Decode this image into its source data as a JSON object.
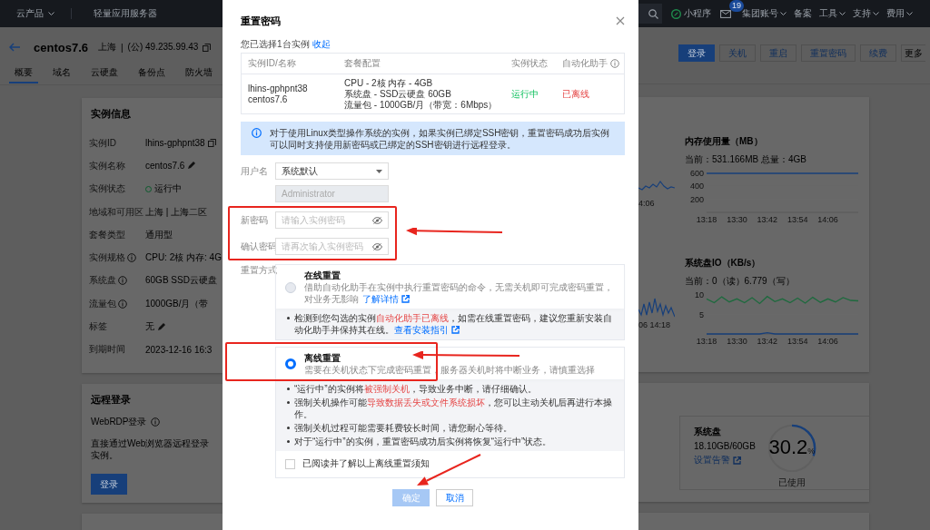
{
  "top_nav": {
    "products": "云产品",
    "service": "轻量应用服务器",
    "mini_program": "小程序",
    "mail_count": "19",
    "menus": [
      {
        "label": "集团账号",
        "dropdown": true
      },
      {
        "label": "备案",
        "dropdown": false
      },
      {
        "label": "工具",
        "dropdown": true
      },
      {
        "label": "支持",
        "dropdown": true
      },
      {
        "label": "费用",
        "dropdown": true
      }
    ]
  },
  "header": {
    "name": "centos7.6",
    "region": "上海",
    "separator": "|",
    "ip": "(公) 49.235.99.43",
    "buttons": [
      {
        "label": "登录",
        "primary": true
      },
      {
        "label": "关机",
        "primary": false
      },
      {
        "label": "重启",
        "primary": false
      },
      {
        "label": "重置密码",
        "primary": false
      },
      {
        "label": "续费",
        "primary": false
      },
      {
        "label": "更多",
        "primary": false
      }
    ]
  },
  "tabs": [
    {
      "label": "概要",
      "selected": true
    },
    {
      "label": "域名",
      "selected": false
    },
    {
      "label": "云硬盘",
      "selected": false
    },
    {
      "label": "备份点",
      "selected": false
    },
    {
      "label": "防火墙",
      "selected": false
    }
  ],
  "instance_info": {
    "title": "实例信息",
    "rows": [
      {
        "label": "实例ID",
        "label_info": false,
        "value": "lhins-gphpnt38",
        "kind": "copy"
      },
      {
        "label": "实例名称",
        "label_info": false,
        "value": "centos7.6",
        "kind": "edit"
      },
      {
        "label": "实例状态",
        "label_info": false,
        "value": "运行中",
        "kind": "status"
      },
      {
        "label": "地域和可用区",
        "label_info": false,
        "value": "上海 | 上海二区",
        "kind": "plain"
      },
      {
        "label": "套餐类型",
        "label_info": false,
        "value": "通用型",
        "kind": "plain"
      },
      {
        "label": "实例规格",
        "label_info": true,
        "value": "CPU: 2核 内存: 4G",
        "kind": "plain"
      },
      {
        "label": "系统盘",
        "label_info": true,
        "value": "60GB SSD云硬盘",
        "kind": "plain"
      },
      {
        "label": "流量包",
        "label_info": true,
        "value": "1000GB/月（带",
        "kind": "plain"
      },
      {
        "label": "标签",
        "label_info": false,
        "value": "无",
        "kind": "edit"
      },
      {
        "label": "到期时间",
        "label_info": false,
        "value": "2023-12-16 16:3",
        "kind": "plain"
      }
    ]
  },
  "remote_login": {
    "title": "远程登录",
    "method": "WebRDP登录",
    "description": "直接通过Web浏览器远程登录实例。",
    "button": "登录"
  },
  "monitor": {
    "fragments": [
      {
        "label": "4:06"
      },
      {
        "label": "06 14:18"
      }
    ],
    "charts": [
      {
        "title": "内存使用量（MB）",
        "current": "当前：531.166MB 总量：4GB",
        "chart_data": {
          "type": "line",
          "categories": [
            "13:18",
            null,
            null,
            null,
            "13:30",
            null,
            null,
            null,
            "13:42",
            null,
            null,
            null,
            "13:54",
            null,
            null,
            null,
            "14:06",
            null,
            null,
            null,
            null
          ],
          "ylim": [
            0,
            600
          ],
          "yticks": [
            200,
            400,
            600
          ],
          "series": [
            {
              "color": "#173f7a",
              "values": [
                600,
                600,
                600,
                600,
                600,
                600,
                600,
                600,
                600,
                600,
                600,
                600,
                600,
                600,
                600,
                600,
                600,
                600,
                600,
                600,
                600
              ]
            }
          ]
        }
      },
      {
        "title": "系统盘IO（KB/s）",
        "current": "当前：0（读）6.779（写）",
        "chart_data": {
          "type": "line",
          "categories": [
            "13:18",
            null,
            null,
            null,
            "13:30",
            null,
            null,
            null,
            "13:42",
            null,
            null,
            null,
            "13:54",
            null,
            null,
            null,
            "14:06",
            null,
            null,
            null,
            null
          ],
          "ylim": [
            0,
            10
          ],
          "yticks": [
            5,
            10
          ],
          "series": [
            {
              "color": "#1e6a3e",
              "values": [
                9,
                8,
                9.5,
                8.2,
                9,
                8,
                9.3,
                7.8,
                9.6,
                8.3,
                9,
                8,
                9.2,
                7.9,
                9.4,
                8.1,
                9,
                8.2,
                9.3,
                8.6,
                8.5
              ]
            },
            {
              "color": "#173f7a",
              "values": [
                0,
                0,
                0,
                0,
                0,
                0,
                0,
                0,
                0.3,
                0,
                0,
                0,
                0,
                0,
                0,
                0,
                0,
                0,
                0,
                0,
                0
              ]
            }
          ]
        }
      }
    ]
  },
  "disk": {
    "title": "系统盘",
    "usage": "18.10GB/60GB",
    "alert_link": "设置告警",
    "percent": "30.2",
    "unit": "%",
    "level": 0.302,
    "caption": "已使用"
  },
  "dialog": {
    "title": "重置密码",
    "selected_text": "您已选择1台实例",
    "collapse_link": "收起",
    "table": {
      "columns": [
        "实例ID/名称",
        "套餐配置",
        "实例状态",
        "自动化助手"
      ],
      "rows": [
        {
          "id": "lhins-gphpnt38",
          "name": "centos7.6",
          "config": [
            "CPU - 2核 内存 - 4GB",
            "系统盘 - SSD云硬盘 60GB",
            "流量包 - 1000GB/月（带宽：6Mbps）"
          ],
          "status": {
            "text": "运行中",
            "kind": "running"
          },
          "agent": {
            "text": "已离线",
            "kind": "offline"
          }
        }
      ]
    },
    "notice": "对于使用Linux类型操作系统的实例，如果实例已绑定SSH密钥，重置密码成功后实例可以同时支持使用新密码或已绑定的SSH密钥进行远程登录。",
    "form": {
      "username": {
        "label": "用户名",
        "value": "系统默认"
      },
      "account": {
        "value": "Administrator",
        "disabled": true
      },
      "new_password": {
        "label": "新密码",
        "placeholder": "请输入实例密码"
      },
      "confirm_password": {
        "label": "确认密码",
        "placeholder": "请再次输入实例密码"
      },
      "method_label": "重置方式"
    },
    "methods": [
      {
        "title": "在线重置",
        "selected": false,
        "description": "借助自动化助手在实例中执行重置密码的命令，无需关机即可完成密码重置，对业务无影响",
        "link": "了解详情",
        "notes": [
          [
            {
              "text": "检测到您勾选的实例",
              "kind": "text"
            },
            {
              "text": "自动化助手已离线",
              "kind": "warn"
            },
            {
              "text": "，如需在线重置密码，建议您重新安装自动化助手并保持其在线。",
              "kind": "text"
            },
            {
              "text": "查看安装指引",
              "kind": "link"
            }
          ]
        ]
      },
      {
        "title": "离线重置",
        "selected": true,
        "description": "需要在关机状态下完成密码重置，服务器关机时将中断业务，请慎重选择",
        "notes": [
          [
            {
              "text": "“运行中”的实例将",
              "kind": "text"
            },
            {
              "text": "被强制关机",
              "kind": "warn"
            },
            {
              "text": "，导致业务中断，请仔细确认。",
              "kind": "text"
            }
          ],
          [
            {
              "text": "强制关机操作可能",
              "kind": "text"
            },
            {
              "text": "导致数据丢失或文件系统损坏",
              "kind": "warn"
            },
            {
              "text": "，您可以主动关机后再进行本操作。",
              "kind": "text"
            }
          ],
          [
            {
              "text": "强制关机过程可能需要耗费较长时间，请您耐心等待。",
              "kind": "text"
            }
          ],
          [
            {
              "text": "对于“运行中”的实例，重置密码成功后实例将恢复“运行中”状态。",
              "kind": "text"
            }
          ]
        ],
        "agreement": {
          "label": "已阅读并了解以上离线重置须知",
          "checked": false
        }
      }
    ],
    "buttons": [
      {
        "label": "确定",
        "kind": "primary",
        "disabled": true
      },
      {
        "label": "取消",
        "kind": "secondary",
        "disabled": false
      }
    ]
  }
}
